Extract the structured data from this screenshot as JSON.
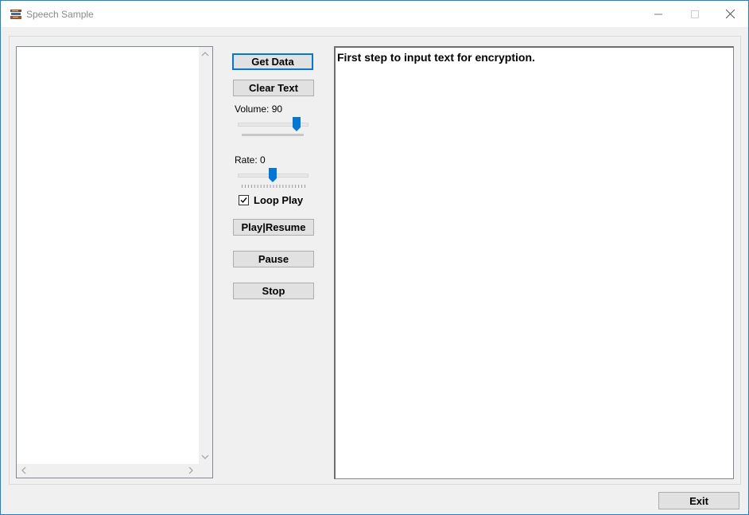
{
  "window": {
    "title": "Speech Sample",
    "icon": "stacked-books-icon",
    "controls": [
      "minimize-icon",
      "maximize-icon",
      "close-icon"
    ]
  },
  "controls": {
    "get_data_label": "Get Data",
    "clear_text_label": "Clear Text",
    "volume": {
      "label": "Volume: 90",
      "value": 90,
      "min": 0,
      "max": 100
    },
    "rate": {
      "label": "Rate: 0",
      "value": 0,
      "min": -10,
      "max": 10
    },
    "loop_play": {
      "label": "Loop Play",
      "checked": true
    },
    "play_resume_label": "Play|Resume",
    "pause_label": "Pause",
    "stop_label": "Stop"
  },
  "text_box": {
    "value": "First step to input text for encryption."
  },
  "footer": {
    "exit_label": "Exit"
  },
  "colors": {
    "accent": "#0078d7",
    "window_border": "#1883d7",
    "background": "#f0f0f0"
  }
}
